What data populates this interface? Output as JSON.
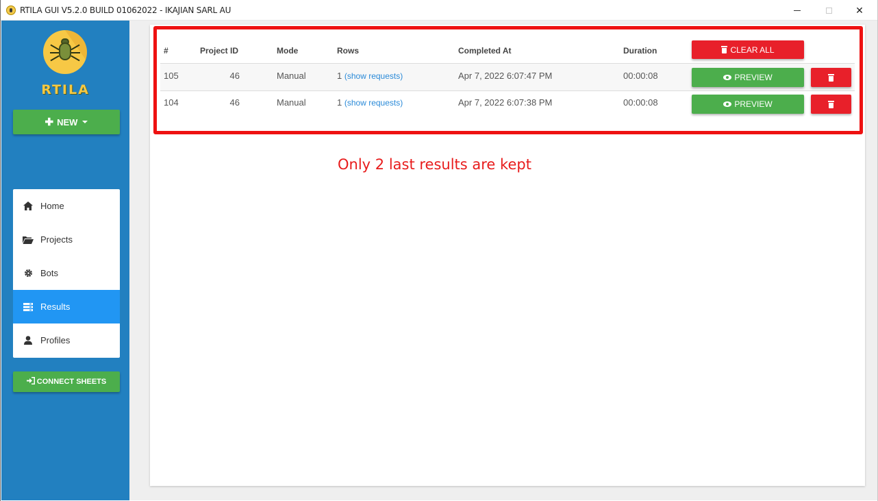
{
  "window": {
    "title": "RTILA GUI V5.2.0 BUILD 01062022 - IKAJIAN SARL AU",
    "min_label": "",
    "close_label": "✕"
  },
  "sidebar": {
    "logo_text": "RTILA",
    "new_button": "NEW",
    "items": [
      {
        "label": "Home",
        "icon": "home-icon"
      },
      {
        "label": "Projects",
        "icon": "folder-open-icon"
      },
      {
        "label": "Bots",
        "icon": "gear-icon"
      },
      {
        "label": "Results",
        "icon": "results-icon"
      },
      {
        "label": "Profiles",
        "icon": "user-icon"
      }
    ],
    "active": "Results",
    "connect_button": "CONNECT SHEETS"
  },
  "table": {
    "headers": [
      "#",
      "Project ID",
      "Mode",
      "Rows",
      "Completed At",
      "Duration"
    ],
    "clear_all_label": "CLEAR ALL",
    "rows": [
      {
        "id": "105",
        "project_id": "46",
        "mode": "Manual",
        "rows": "1",
        "rows_link": "(show requests)",
        "completed_at": "Apr 7, 2022 6:07:47 PM",
        "duration": "00:00:08",
        "preview_label": "PREVIEW"
      },
      {
        "id": "104",
        "project_id": "46",
        "mode": "Manual",
        "rows": "1",
        "rows_link": "(show requests)",
        "completed_at": "Apr 7, 2022 6:07:38 PM",
        "duration": "00:00:08",
        "preview_label": "PREVIEW"
      }
    ]
  },
  "annotation": "Only 2 last results are kept",
  "colors": {
    "sidebar": "#2280c0",
    "active_nav": "#2196f3",
    "green_button": "#4cae4c",
    "red_button": "#e8202a",
    "highlight_border": "#ee1111",
    "annotation_text": "#e81c1c"
  }
}
